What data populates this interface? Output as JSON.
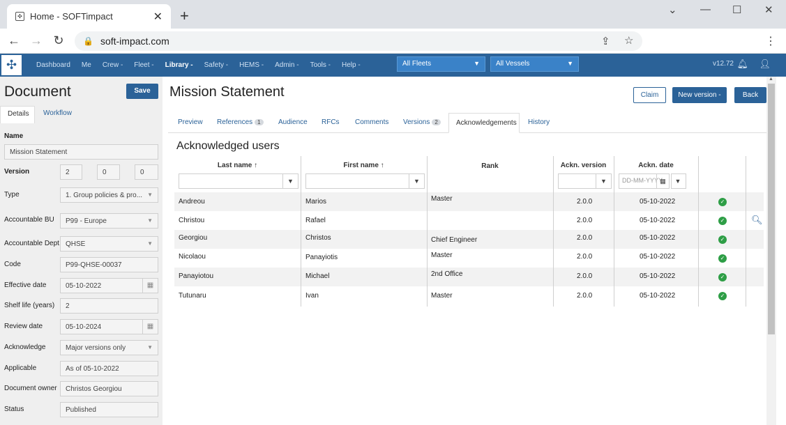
{
  "browser": {
    "tab_title": "Home - SOFTimpact",
    "url": "soft-impact.com"
  },
  "appnav": {
    "items": [
      "Dashboard",
      "Me",
      "Crew -",
      "Fleet -",
      "Library -",
      "Safety -",
      "HEMS -",
      "Admin -",
      "Tools -",
      "Help -"
    ],
    "fleet_select": "All Fleets",
    "vessel_select": "All Vessels",
    "version": "v12.72"
  },
  "sidebar": {
    "title": "Document",
    "save_label": "Save",
    "tabs": [
      "Details",
      "Workflow"
    ],
    "name_label": "Name",
    "name_value": "Mission Statement",
    "version_label": "Version",
    "version_parts": [
      "2",
      "0",
      "0"
    ],
    "fields": [
      {
        "label": "Type",
        "value": "1. Group policies & pro...",
        "kind": "dropdown"
      },
      {
        "label": "Accountable BU",
        "value": "P99 - Europe",
        "kind": "dropdown"
      },
      {
        "label": "Accountable Dept.",
        "value": "QHSE",
        "kind": "dropdown"
      },
      {
        "label": "Code",
        "value": "P99-QHSE-00037",
        "kind": "text"
      },
      {
        "label": "Effective date",
        "value": "05-10-2022",
        "kind": "date"
      },
      {
        "label": "Shelf life (years)",
        "value": "2",
        "kind": "text"
      },
      {
        "label": "Review date",
        "value": "05-10-2024",
        "kind": "date"
      },
      {
        "label": "Acknowledge",
        "value": "Major versions only",
        "kind": "dropdown"
      },
      {
        "label": "Applicable",
        "value": "As of 05-10-2022",
        "kind": "text"
      },
      {
        "label": "Document owner",
        "value": "Christos Georgiou",
        "kind": "text"
      },
      {
        "label": "Status",
        "value": "Published",
        "kind": "text"
      }
    ]
  },
  "content": {
    "title": "Mission Statement",
    "buttons": {
      "claim": "Claim",
      "new_version": "New version -",
      "back": "Back"
    },
    "tabs": [
      {
        "label": "Preview"
      },
      {
        "label": "References",
        "badge": "1"
      },
      {
        "label": "Audience"
      },
      {
        "label": "RFCs"
      },
      {
        "label": "Comments"
      },
      {
        "label": "Versions",
        "badge": "2"
      },
      {
        "label": "Acknowledgements"
      },
      {
        "label": "History"
      }
    ],
    "ack_title": "Acknowledged users",
    "columns": [
      "Last name ↑",
      "First name ↑",
      "Rank",
      "Ackn. version",
      "Ackn. date"
    ],
    "date_placeholder": "DD-MM-YYYY",
    "rows": [
      {
        "last": "Andreou",
        "first": "Marios",
        "rank": "Master",
        "version": "2.0.0",
        "date": "05-10-2022"
      },
      {
        "last": "Christou",
        "first": "Rafael",
        "rank": "",
        "version": "2.0.0",
        "date": "05-10-2022"
      },
      {
        "last": "Georgiou",
        "first": "Christos",
        "rank": "Chief Engineer",
        "version": "2.0.0",
        "date": "05-10-2022"
      },
      {
        "last": "Nicolaou",
        "first": "Panayiotis",
        "rank": "Master",
        "version": "2.0.0",
        "date": "05-10-2022"
      },
      {
        "last": "Panayiotou",
        "first": "Michael",
        "rank": "2nd Office",
        "version": "2.0.0",
        "date": "05-10-2022"
      },
      {
        "last": "Tutunaru",
        "first": "Ivan",
        "rank": "Master",
        "version": "2.0.0",
        "date": "05-10-2022"
      }
    ]
  },
  "colors": {
    "brand": "#2b6298",
    "ok": "#2e9e46"
  }
}
